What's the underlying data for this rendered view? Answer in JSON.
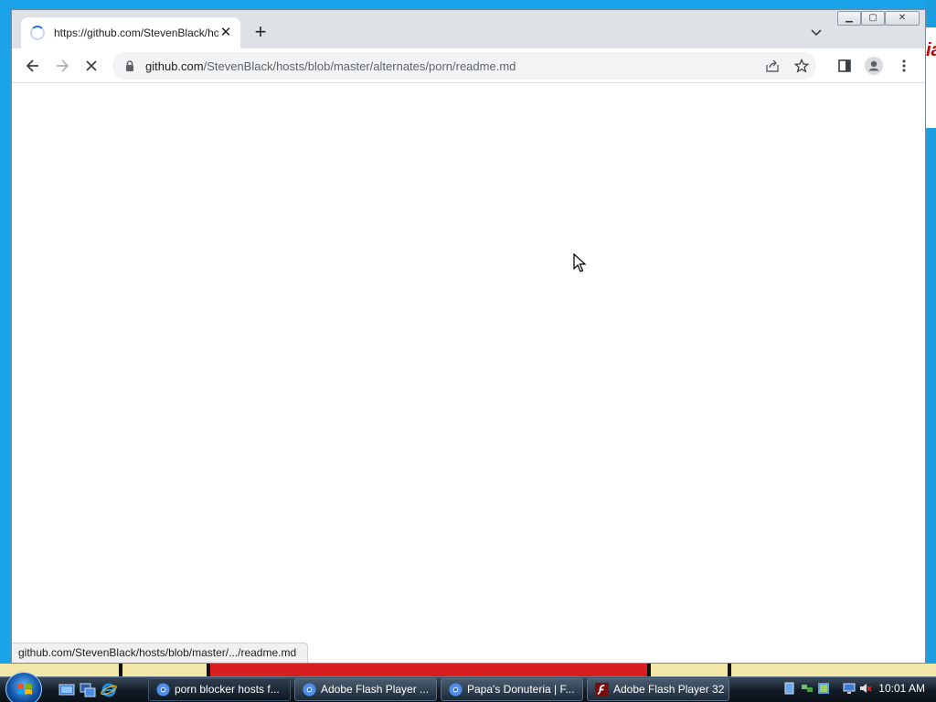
{
  "browser": {
    "tab": {
      "title": "https://github.com/StevenBlack/hosts/blob/master/alternates/porn/readme.md"
    },
    "address_bar": {
      "domain": "github.com",
      "path": "/StevenBlack/hosts/blob/master/alternates/porn/readme.md"
    },
    "status_bubble": "github.com/StevenBlack/hosts/blob/master/.../readme.md",
    "icons": {
      "back": "back-arrow-icon",
      "forward": "forward-arrow-icon",
      "stop": "stop-x-icon",
      "share": "share-icon",
      "bookmark": "star-icon",
      "side_panel": "side-panel-icon",
      "profile": "profile-icon",
      "menu": "kebab-menu-icon"
    }
  },
  "taskbar": {
    "buttons": [
      {
        "label": "porn blocker hosts f...",
        "icon": "chrome-icon",
        "active": true
      },
      {
        "label": "Adobe Flash Player ...",
        "icon": "chrome-icon",
        "active": false
      },
      {
        "label": "Papa's Donuteria | F...",
        "icon": "chrome-icon",
        "active": false
      },
      {
        "label": "Adobe Flash Player 32",
        "icon": "flash-icon",
        "active": false
      }
    ],
    "clock": "10:01 AM"
  },
  "colors": {
    "accent": "#1a73e8",
    "desktop": "#1aa3e8",
    "chrome_frame": "#dee1e6"
  }
}
